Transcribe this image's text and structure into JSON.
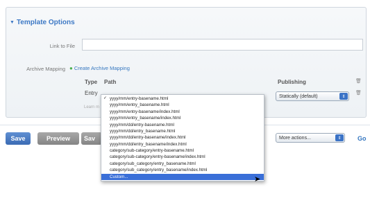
{
  "panel": {
    "title": "Template Options",
    "link_to_file_label": "Link to File",
    "link_to_file_value": "",
    "archive_mapping_label": "Archive Mapping",
    "create_mapping_link": "Create Archive Mapping",
    "table": {
      "col_type": "Type",
      "col_path": "Path",
      "col_publishing": "Publishing",
      "row_type": "Entry",
      "learn_more": "Learn m"
    },
    "publishing_select_value": "Statically (default)"
  },
  "dropdown": {
    "checked_index": 0,
    "selected_index": 14,
    "options": [
      "yyyy/mm/entry-basename.html",
      "yyyy/mm/entry_basename.html",
      "yyyy/mm/entry-basename/index.html",
      "yyyy/mm/entry_basename/index.html",
      "yyyy/mm/dd/entry-basename.html",
      "yyyy/mm/dd/entry_basename.html",
      "yyyy/mm/dd/entry-basename/index.html",
      "yyyy/mm/dd/entry_basename/index.html",
      "category/sub-category/entry-basename.html",
      "category/sub-category/entry-basename/index.html",
      "category/sub_category/entry_basename.html",
      "category/sub_category/entry_basename/index.html",
      "Custom..."
    ]
  },
  "toolbar": {
    "save_label": "Save",
    "preview_label": "Preview",
    "save2_label": "Sav",
    "more_actions_value": "More actions...",
    "go_label": "Go"
  },
  "colors": {
    "accent": "#3d79c5",
    "selected_item": "#3a6fd8",
    "create_link_green": "#4caf50"
  }
}
